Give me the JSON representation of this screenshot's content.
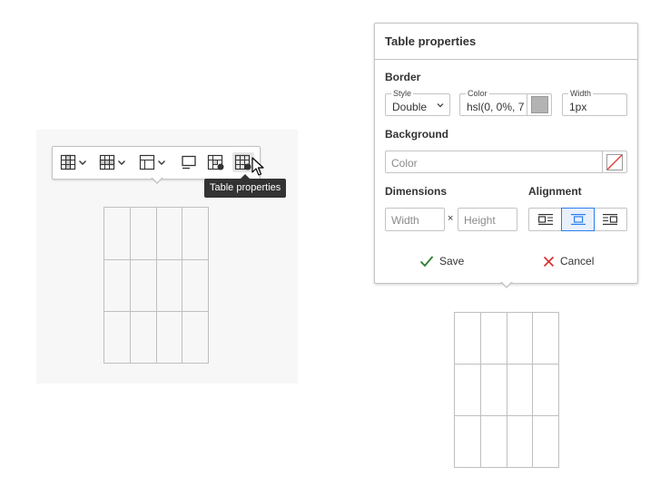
{
  "toolbar": {
    "buttons": [
      {
        "name": "table-column"
      },
      {
        "name": "table-row"
      },
      {
        "name": "merge-table-cells"
      },
      {
        "name": "toggle-caption"
      },
      {
        "name": "table-cell-properties"
      },
      {
        "name": "table-properties"
      }
    ],
    "tooltip": "Table properties"
  },
  "panel": {
    "title": "Table properties",
    "border": {
      "label": "Border",
      "style_label": "Style",
      "style_value": "Double",
      "color_label": "Color",
      "color_value": "hsl(0, 0%, 7",
      "color_swatch": "#b3b3b3",
      "width_label": "Width",
      "width_value": "1px"
    },
    "background": {
      "label": "Background",
      "color_placeholder": "Color"
    },
    "dimensions": {
      "label": "Dimensions",
      "width_placeholder": "Width",
      "separator": "×",
      "height_placeholder": "Height"
    },
    "alignment": {
      "label": "Alignment",
      "options": [
        "align-left",
        "align-center",
        "align-right"
      ],
      "selected": "align-center"
    },
    "save_label": "Save",
    "cancel_label": "Cancel"
  },
  "colors": {
    "accent": "#2a7ef0",
    "save_check": "#2e7d32",
    "cancel_x": "#d32f2f"
  }
}
